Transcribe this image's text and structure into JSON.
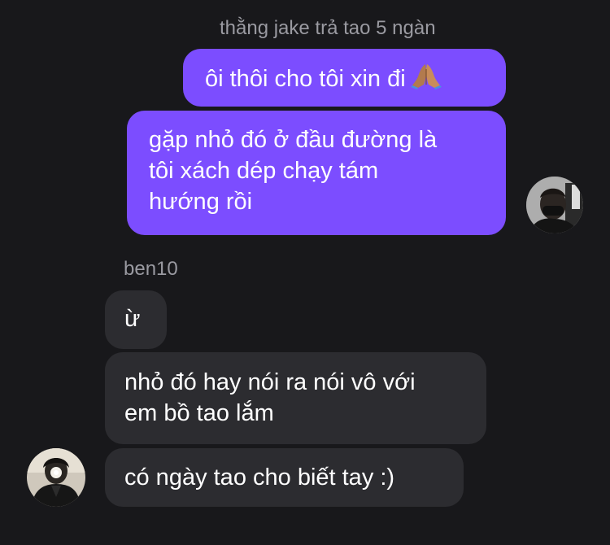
{
  "reply_context": "thằng jake trả tao 5 ngàn",
  "outgoing_messages": [
    {
      "text": "ôi thôi cho tôi xin đi",
      "emoji_icon": "folded-hands-icon"
    },
    {
      "lines": [
        "gặp nhỏ đó ở đầu đường là",
        "tôi xách dép chạy tám",
        "hướng rồi"
      ]
    }
  ],
  "incoming": {
    "sender_name": "ben10",
    "messages": [
      {
        "text": "ừ"
      },
      {
        "lines": [
          "nhỏ đó hay nói ra nói vô với",
          "em bồ tao lắm"
        ]
      },
      {
        "text": "có ngày tao cho biết tay :)"
      }
    ]
  },
  "colors": {
    "background": "#18181b",
    "outgoing_bubble": "#7c4dff",
    "incoming_bubble": "#2c2c30",
    "meta_text": "#9a9aa1"
  }
}
